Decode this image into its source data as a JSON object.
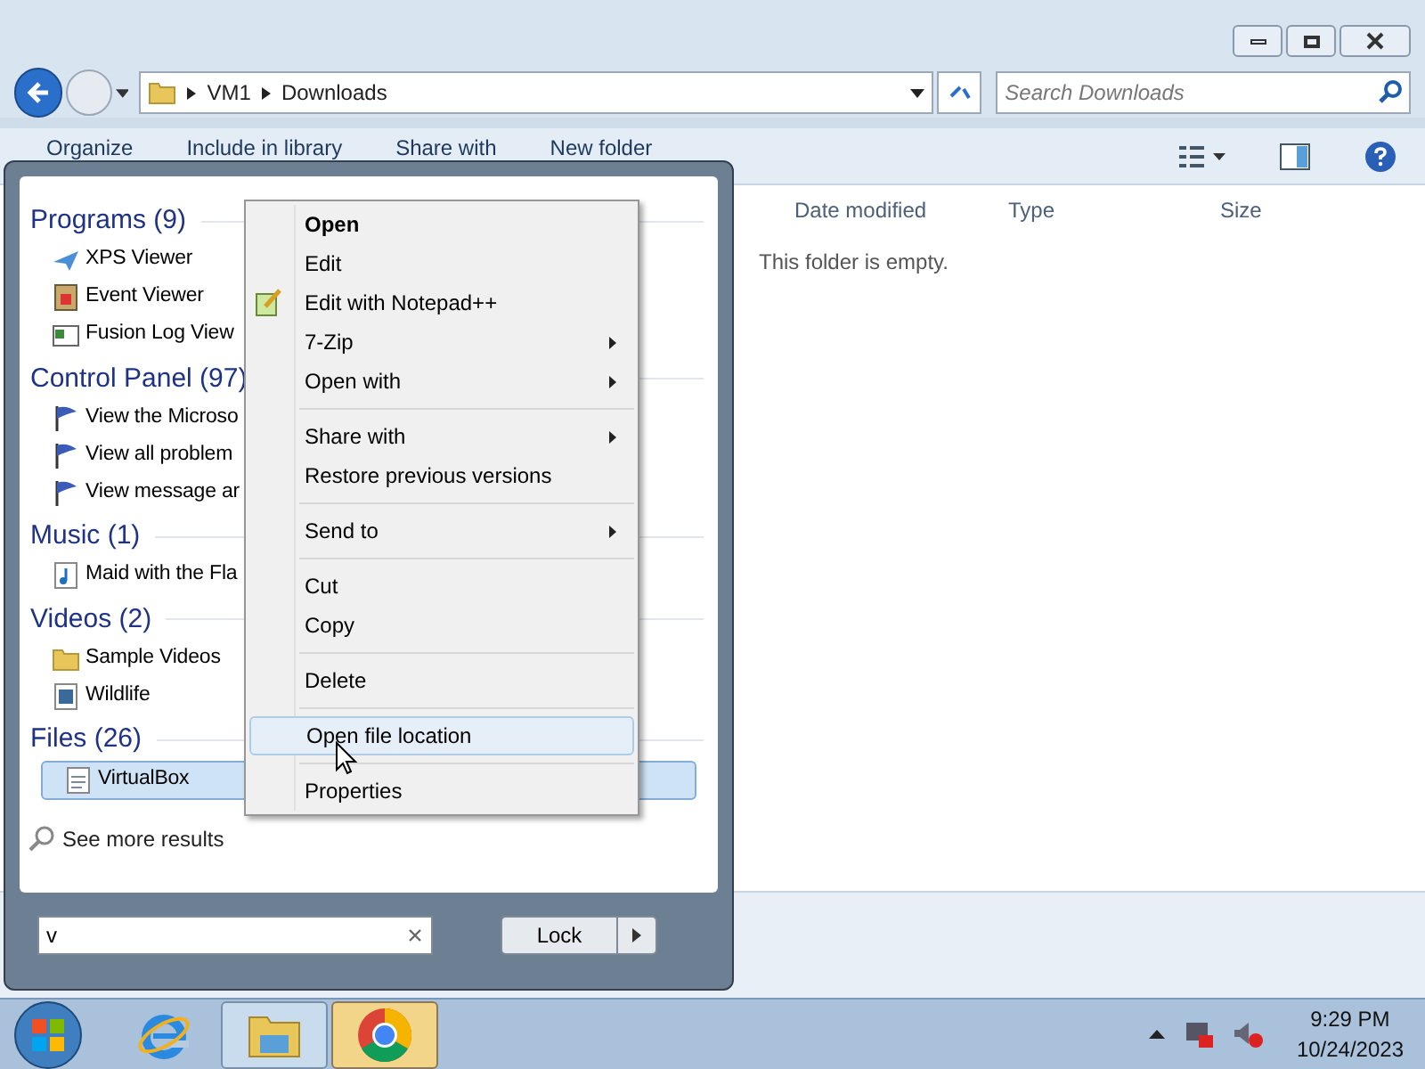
{
  "address_bar": {
    "path": [
      "VM1",
      "Downloads"
    ]
  },
  "search": {
    "placeholder": "Search Downloads"
  },
  "toolbar": {
    "items": [
      "Organize",
      "Include in library",
      "Share with",
      "New folder"
    ]
  },
  "columns": [
    "Date modified",
    "Type",
    "Size"
  ],
  "empty_message": "This folder is empty.",
  "start_menu": {
    "groups": [
      {
        "title": "Programs (9)",
        "items": [
          {
            "label": "XPS Viewer",
            "kind": "xps",
            "selected": false
          },
          {
            "label": "Event Viewer",
            "kind": "event",
            "selected": false
          },
          {
            "label": "Fusion Log View",
            "kind": "log",
            "selected": false
          }
        ]
      },
      {
        "title": "Control Panel (97)",
        "items": [
          {
            "label": "View the Microso",
            "kind": "flag",
            "selected": false
          },
          {
            "label": "View all problem",
            "kind": "flag",
            "selected": false
          },
          {
            "label": "View message ar",
            "kind": "flag",
            "selected": false
          }
        ]
      },
      {
        "title": "Music (1)",
        "items": [
          {
            "label": "Maid with the Fla",
            "kind": "music",
            "selected": false
          }
        ]
      },
      {
        "title": "Videos (2)",
        "items": [
          {
            "label": "Sample Videos",
            "kind": "folder",
            "selected": false
          },
          {
            "label": "Wildlife",
            "kind": "video",
            "selected": false
          }
        ]
      },
      {
        "title": "Files (26)",
        "items": [
          {
            "label": "VirtualBox",
            "kind": "file",
            "selected": true
          }
        ]
      }
    ],
    "see_more": "See more results",
    "search_box": {
      "value": "v"
    },
    "power_button": "Lock"
  },
  "context_menu": {
    "items": [
      {
        "kind": "item",
        "label": "Open",
        "default": true,
        "submenu": false,
        "selected": false
      },
      {
        "kind": "item",
        "label": "Edit",
        "default": false,
        "submenu": false,
        "selected": false
      },
      {
        "kind": "notepad_item",
        "label": "Edit with Notepad++",
        "default": false,
        "submenu": false,
        "selected": false
      },
      {
        "kind": "item",
        "label": "7-Zip",
        "default": false,
        "submenu": true,
        "selected": false
      },
      {
        "kind": "item",
        "label": "Open with",
        "default": false,
        "submenu": true,
        "selected": false
      },
      {
        "kind": "separator"
      },
      {
        "kind": "item",
        "label": "Share with",
        "default": false,
        "submenu": true,
        "selected": false
      },
      {
        "kind": "item",
        "label": "Restore previous versions",
        "default": false,
        "submenu": false,
        "selected": false
      },
      {
        "kind": "separator"
      },
      {
        "kind": "item",
        "label": "Send to",
        "default": false,
        "submenu": true,
        "selected": false
      },
      {
        "kind": "separator"
      },
      {
        "kind": "item",
        "label": "Cut",
        "default": false,
        "submenu": false,
        "selected": false
      },
      {
        "kind": "item",
        "label": "Copy",
        "default": false,
        "submenu": false,
        "selected": false
      },
      {
        "kind": "separator"
      },
      {
        "kind": "item",
        "label": "Delete",
        "default": false,
        "submenu": false,
        "selected": false
      },
      {
        "kind": "separator"
      },
      {
        "kind": "item",
        "label": "Open file location",
        "default": false,
        "submenu": false,
        "selected": true
      },
      {
        "kind": "separator"
      },
      {
        "kind": "item",
        "label": "Properties",
        "default": false,
        "submenu": false,
        "selected": false
      }
    ]
  },
  "taskbar": {
    "apps": [
      {
        "kind": "ie",
        "active": false
      },
      {
        "kind": "explorer",
        "active": true
      },
      {
        "kind": "chrome",
        "active": true
      }
    ],
    "clock": {
      "time": "9:29 PM",
      "date": "10/24/2023"
    }
  }
}
